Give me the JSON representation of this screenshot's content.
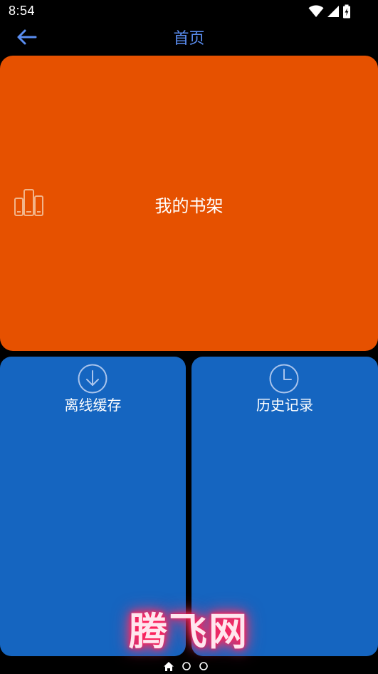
{
  "status_bar": {
    "time": "8:54",
    "icons": [
      "wifi-icon",
      "signal-icon",
      "battery-charging-icon"
    ]
  },
  "app_bar": {
    "back_icon": "arrow-left-icon",
    "title": "首页"
  },
  "tiles": {
    "bookshelf": {
      "label": "我的书架",
      "icon": "bookshelf-icon"
    },
    "offline_cache": {
      "label": "离线缓存",
      "icon": "download-circle-icon"
    },
    "history": {
      "label": "历史记录",
      "icon": "clock-icon"
    }
  },
  "watermark": "腾飞网",
  "pager": {
    "items": [
      "home-icon",
      "page-dot",
      "page-dot"
    ],
    "active_index": 0
  },
  "colors": {
    "background": "#000000",
    "title_accent": "#5a8df0",
    "bookshelf_tile": "#e65100",
    "blue_tile": "#1565c0",
    "text": "#ffffff",
    "watermark_glow": "#ff1f5a"
  }
}
